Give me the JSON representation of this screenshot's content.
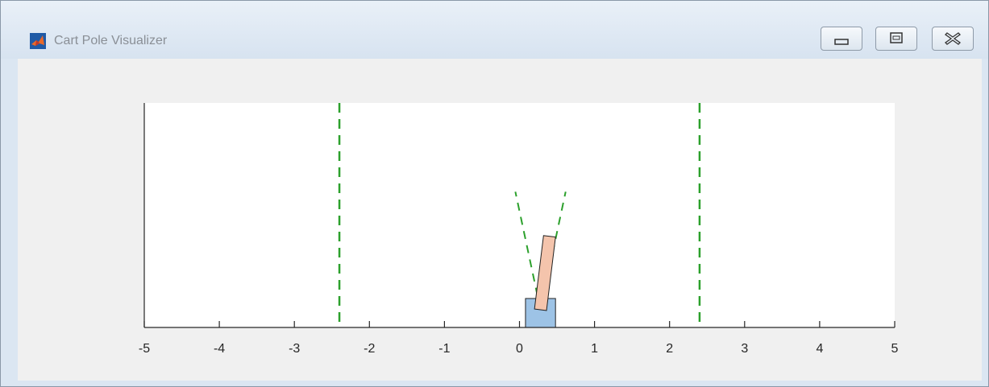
{
  "window": {
    "title": "Cart Pole Visualizer",
    "app_icon": "matlab-logo-icon",
    "controls": [
      "minimize-icon",
      "maximize-icon",
      "close-icon"
    ]
  },
  "chart_data": {
    "type": "scatter",
    "title": "",
    "xlabel": "",
    "ylabel": "",
    "xlim": [
      -5,
      5
    ],
    "xticks": [
      -5,
      -4,
      -3,
      -2,
      -1,
      0,
      1,
      2,
      3,
      4,
      5
    ],
    "grid": false,
    "boundaries": [
      -2.4,
      2.4
    ],
    "cart": {
      "x": 0.28,
      "color": "#9dc3e6"
    },
    "pole": {
      "angle_deg": 7,
      "color": "#f4c4ac"
    },
    "angle_limits_deg": [
      -12,
      12
    ],
    "boundary_color": "#2ca02c"
  }
}
